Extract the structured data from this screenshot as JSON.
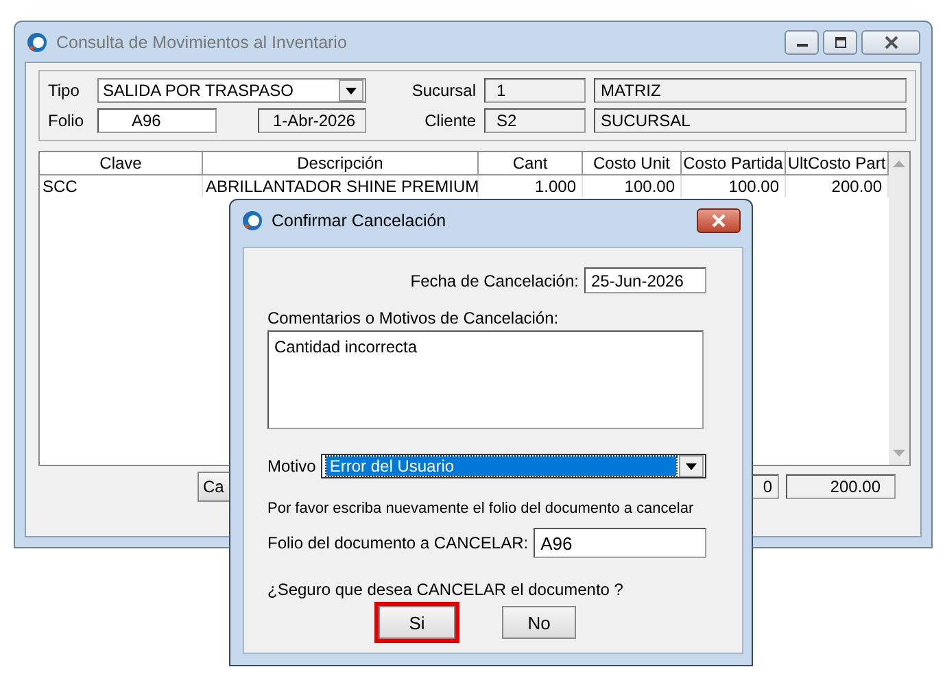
{
  "window": {
    "title": "Consulta de Movimientos al Inventario"
  },
  "header": {
    "tipo_label": "Tipo",
    "tipo_value": "SALIDA POR TRASPASO",
    "folio_label": "Folio",
    "folio_value": "A96",
    "fecha": "1-Abr-2026",
    "sucursal_label": "Sucursal",
    "sucursal_code": "1",
    "sucursal_name": "MATRIZ",
    "cliente_label": "Cliente",
    "cliente_code": "S2",
    "cliente_name": "SUCURSAL"
  },
  "table": {
    "columns": [
      "Clave",
      "Descripción",
      "Cant",
      "Costo Unit",
      "Costo Partida",
      "UltCosto Part"
    ],
    "rows": [
      [
        "SCC",
        "ABRILLANTADOR SHINE PREMIUM",
        "1.000",
        "100.00",
        "100.00",
        "200.00"
      ]
    ]
  },
  "footer": {
    "button": "Ca",
    "field_1": "0",
    "field_2": "200.00"
  },
  "dialog": {
    "title": "Confirmar Cancelación",
    "fecha_label": "Fecha de Cancelación:",
    "fecha_value": "25-Jun-2026",
    "comentarios_label": "Comentarios o Motivos de Cancelación:",
    "comentarios_value": "Cantidad incorrecta",
    "motivo_label": "Motivo",
    "motivo_value": "Error del Usuario",
    "instruction": "Por favor escriba nuevamente el folio del documento a cancelar",
    "folio_label": "Folio del documento a CANCELAR:",
    "folio_value": "A96",
    "question": "¿Seguro que desea CANCELAR el documento ?",
    "buttons": [
      {
        "label": "Si",
        "focused": true
      },
      {
        "label": "No",
        "focused": false
      }
    ]
  }
}
